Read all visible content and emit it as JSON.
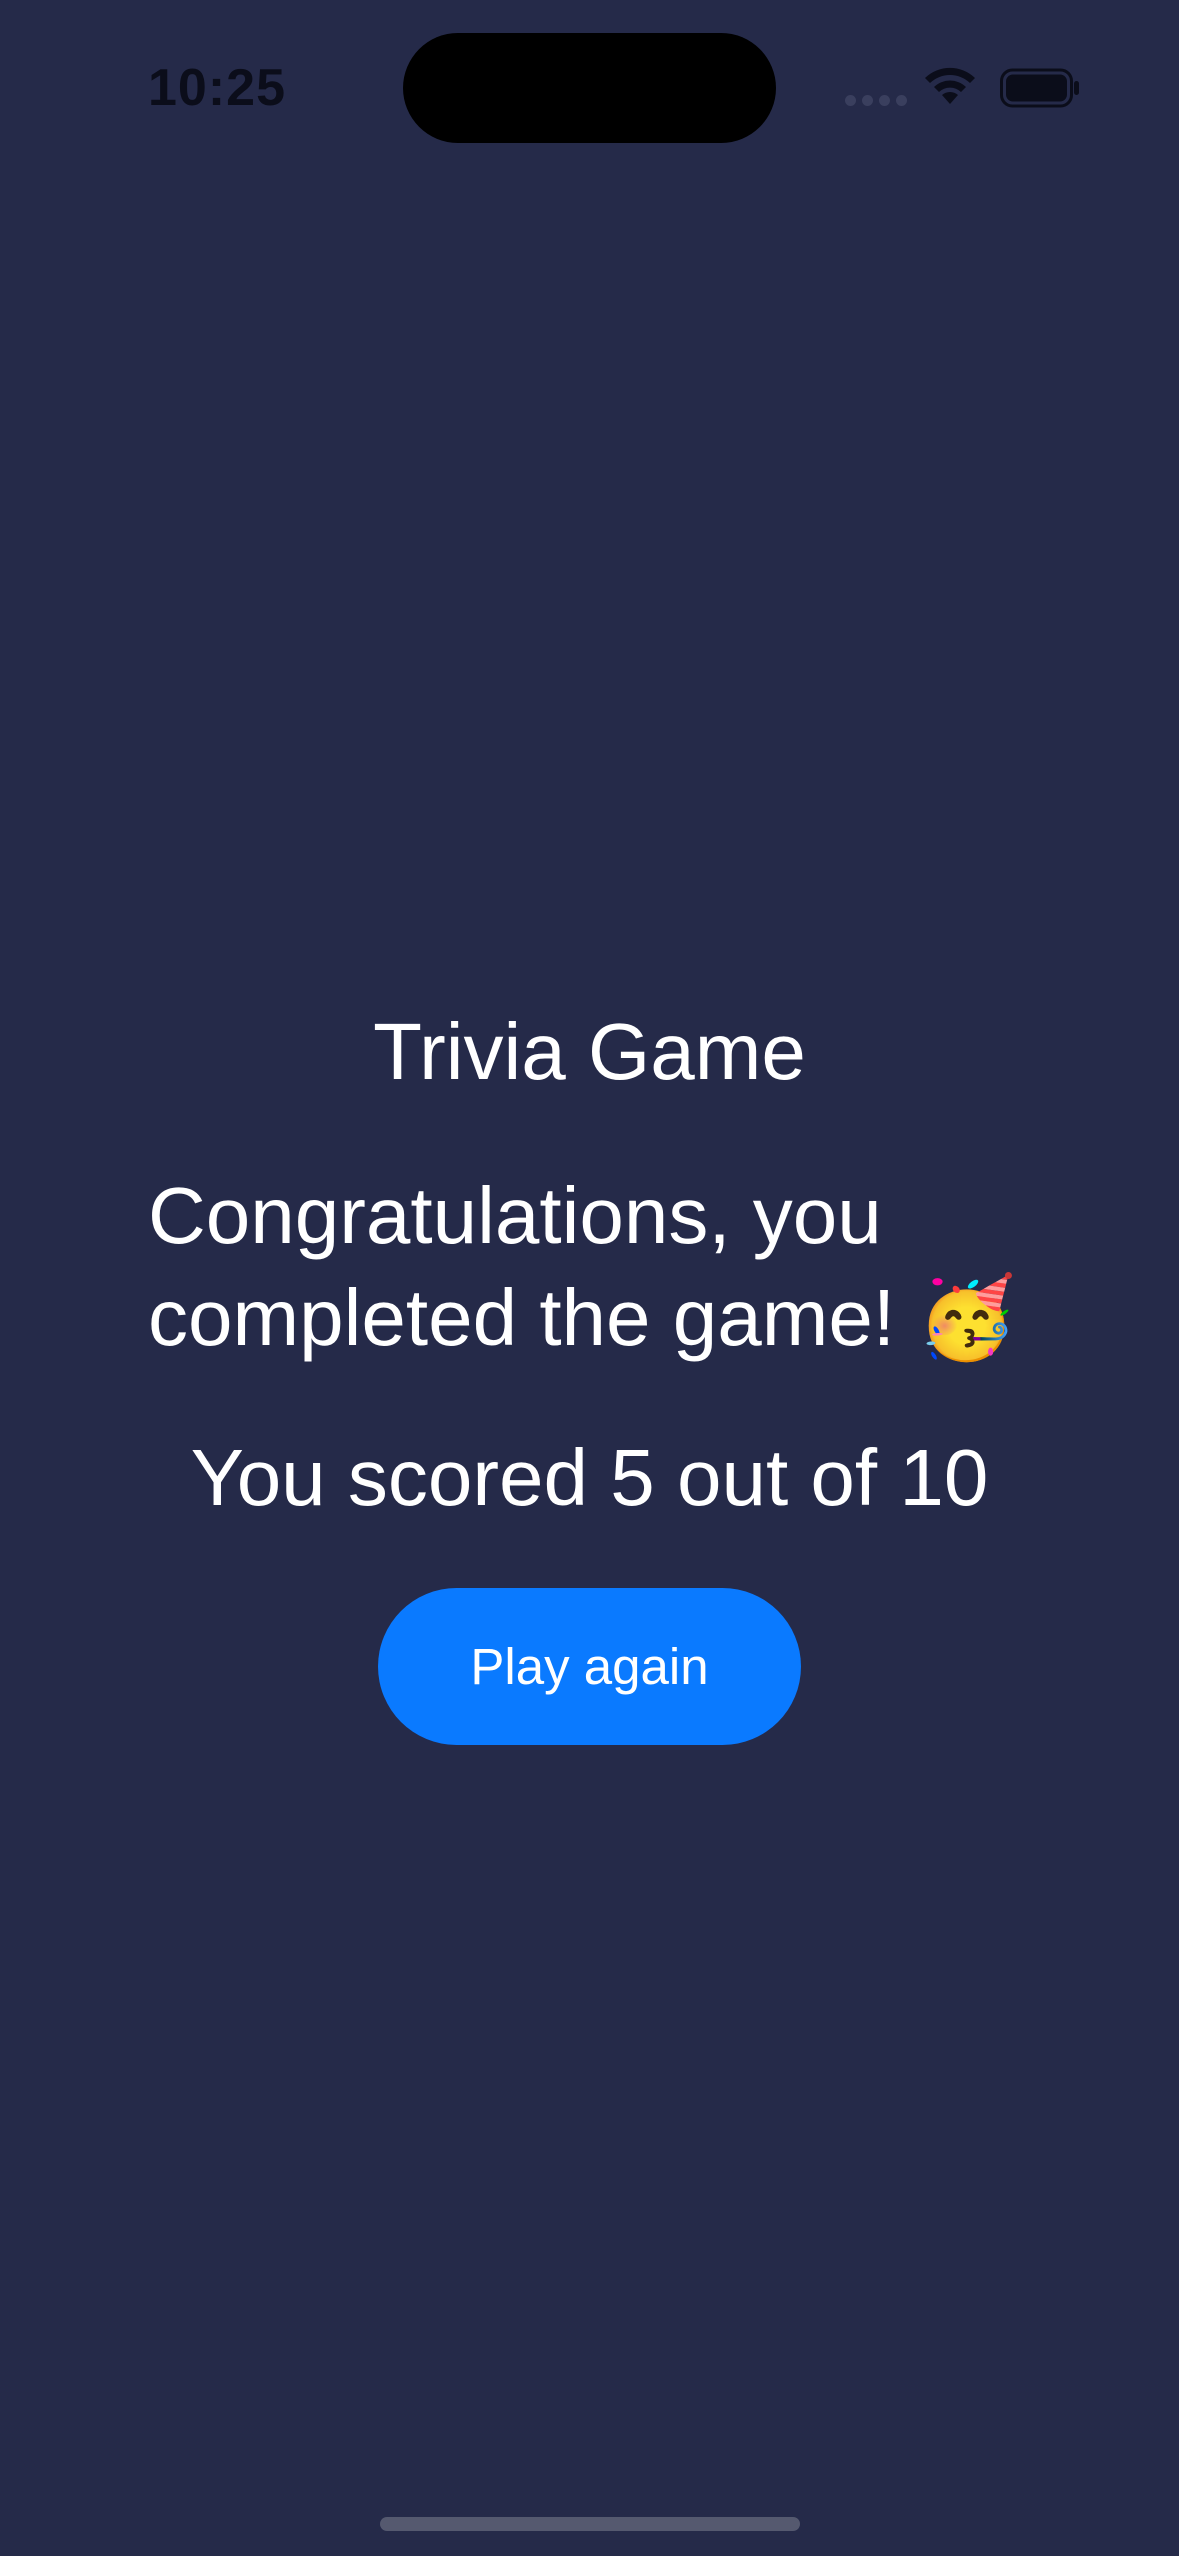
{
  "status_bar": {
    "time": "10:25",
    "icons": [
      "cellular-signal-icon",
      "wifi-icon",
      "battery-icon"
    ]
  },
  "screen": {
    "title": "Trivia Game",
    "message": "Congratulations, you completed the game! 🥳",
    "score_text": "You scored 5 out of 10",
    "play_again_label": "Play again"
  },
  "colors": {
    "background": "#252a49",
    "accent": "#0a7aff",
    "text": "#ffffff"
  }
}
